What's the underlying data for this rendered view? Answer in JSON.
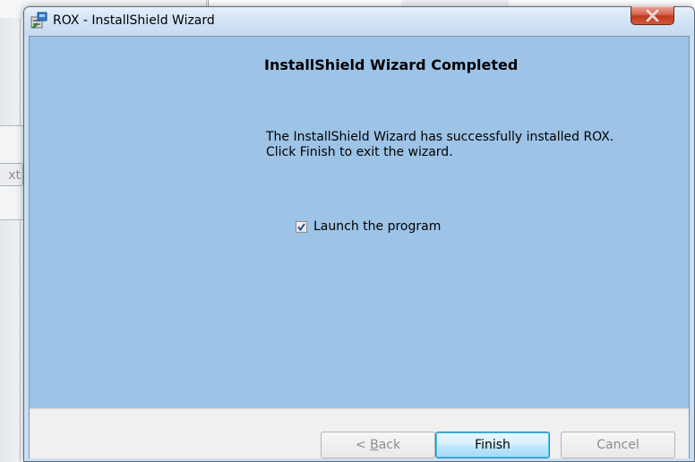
{
  "background": {
    "partial_button_text": "xt"
  },
  "window": {
    "title": "ROX - InstallShield Wizard",
    "close_icon": "close-icon",
    "app_icon": "installer-icon"
  },
  "content": {
    "heading": "InstallShield Wizard Completed",
    "message_line1": "The InstallShield Wizard has successfully installed ROX.",
    "message_line2": "Click Finish to exit the wizard.",
    "checkbox": {
      "label": "Launch the program",
      "checked": true
    }
  },
  "buttons": {
    "back_prefix": "< ",
    "back_mnemonic": "B",
    "back_rest": "ack",
    "finish": "Finish",
    "cancel": "Cancel"
  },
  "colors": {
    "panel_background": "#9dc3e6",
    "button_bar": "#f0f0f0",
    "close_button": "#c9452d",
    "default_button_border": "#3c7fb1"
  }
}
